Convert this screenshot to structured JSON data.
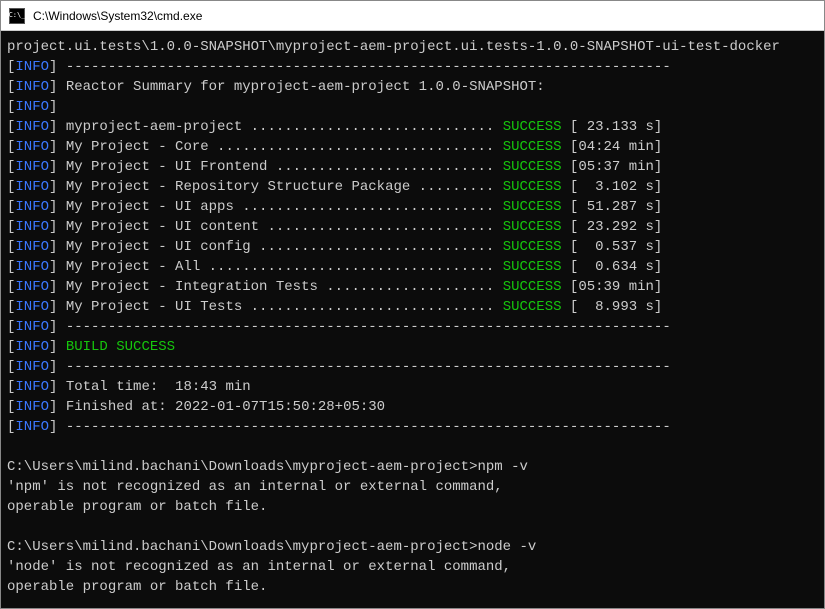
{
  "window": {
    "title": "C:\\Windows\\System32\\cmd.exe"
  },
  "top_line": "project.ui.tests\\1.0.0-SNAPSHOT\\myproject-aem-project.ui.tests-1.0.0-SNAPSHOT-ui-test-docker",
  "info_prefix": "INFO",
  "dashed": "------------------------------------------------------------------------",
  "reactor_summary": "Reactor Summary for myproject-aem-project 1.0.0-SNAPSHOT:",
  "success_label": "SUCCESS",
  "modules": [
    {
      "name": "myproject-aem-project ............................. ",
      "time": "[ 23.133 s]"
    },
    {
      "name": "My Project - Core ................................. ",
      "time": "[04:24 min]"
    },
    {
      "name": "My Project - UI Frontend .......................... ",
      "time": "[05:37 min]"
    },
    {
      "name": "My Project - Repository Structure Package ......... ",
      "time": "[  3.102 s]"
    },
    {
      "name": "My Project - UI apps .............................. ",
      "time": "[ 51.287 s]"
    },
    {
      "name": "My Project - UI content ........................... ",
      "time": "[ 23.292 s]"
    },
    {
      "name": "My Project - UI config ............................ ",
      "time": "[  0.537 s]"
    },
    {
      "name": "My Project - All .................................. ",
      "time": "[  0.634 s]"
    },
    {
      "name": "My Project - Integration Tests .................... ",
      "time": "[05:39 min]"
    },
    {
      "name": "My Project - UI Tests ............................. ",
      "time": "[  8.993 s]"
    }
  ],
  "build_success": "BUILD SUCCESS",
  "total_time": "Total time:  18:43 min",
  "finished_at": "Finished at: 2022-01-07T15:50:28+05:30",
  "prompt1": "C:\\Users\\milind.bachani\\Downloads\\myproject-aem-project>npm -v",
  "err_npm1": "'npm' is not recognized as an internal or external command,",
  "err_npm2": "operable program or batch file.",
  "prompt2": "C:\\Users\\milind.bachani\\Downloads\\myproject-aem-project>node -v",
  "err_node1": "'node' is not recognized as an internal or external command,",
  "err_node2": "operable program or batch file."
}
